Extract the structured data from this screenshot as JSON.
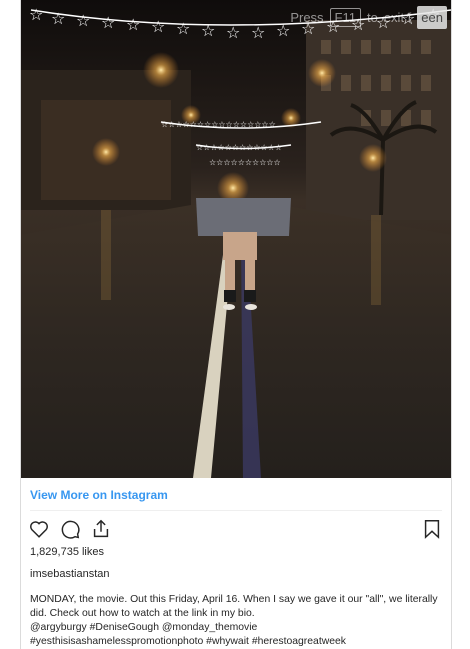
{
  "overlay": {
    "press_text": "Press",
    "key_text": "F11",
    "to_text": "to",
    "exit_text": "exit f",
    "pill_text": "een"
  },
  "link": {
    "view_more": "View More on Instagram"
  },
  "post": {
    "likes": "1,829,735 likes",
    "username": "imsebastianstan",
    "caption_text": "MONDAY, the movie. Out this Friday, April 16. When I say we gave it our \"all\", we literally did. Check out how to watch at the link in my bio.",
    "mentions": [
      "@argyburgy",
      "#DeniseGough",
      "@monday_themovie"
    ],
    "hashtags": [
      "#yesthisisashamelesspromotionphoto",
      "#whywait",
      "#herestoagreatweek"
    ]
  },
  "icons": {
    "like": "heart-icon",
    "comment": "comment-icon",
    "share": "share-icon",
    "save": "bookmark-icon"
  },
  "colors": {
    "link": "#3897f0",
    "text": "#262626",
    "divider": "#efefef"
  }
}
